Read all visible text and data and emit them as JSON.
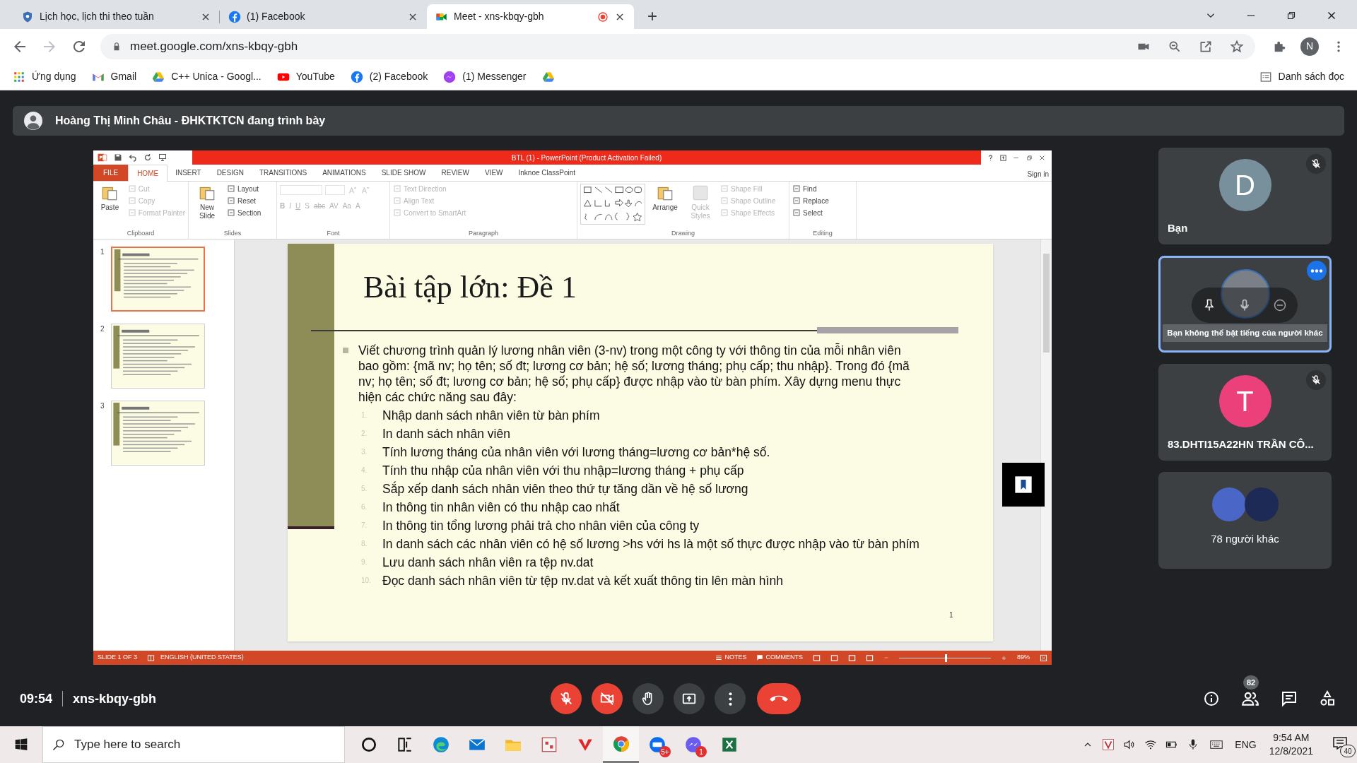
{
  "browser": {
    "tabs": [
      {
        "title": "Lịch học, lịch thi theo tuần",
        "kind": "school",
        "selected": false,
        "recording": false
      },
      {
        "title": "(1) Facebook",
        "kind": "facebook",
        "selected": false,
        "recording": false
      },
      {
        "title": "Meet - xns-kbqy-gbh",
        "kind": "meet",
        "selected": true,
        "recording": true
      }
    ],
    "address": "meet.google.com/xns-kbqy-gbh",
    "profile_initial": "N",
    "bookmarks": [
      {
        "label": "Ứng dụng",
        "kind": "apps"
      },
      {
        "label": "Gmail",
        "kind": "gmail"
      },
      {
        "label": "C++ Unica - Googl...",
        "kind": "drive"
      },
      {
        "label": "YouTube",
        "kind": "youtube"
      },
      {
        "label": "(2) Facebook",
        "kind": "facebook"
      },
      {
        "label": "(1) Messenger",
        "kind": "messenger"
      },
      {
        "kind": "drive"
      }
    ],
    "reading_list": "Danh sách đọc"
  },
  "presenter_banner": "Hoàng Thị Minh Châu - ĐHKTKTCN đang trình bày",
  "powerpoint": {
    "title": "BTL (1) -  PowerPoint (Product Activation Failed)",
    "sign_in": "Sign in",
    "menu_tabs": [
      {
        "label": "FILE",
        "kind": "file",
        "selected": false
      },
      {
        "label": "HOME",
        "kind": "tab",
        "selected": true
      },
      {
        "label": "INSERT",
        "kind": "tab",
        "selected": false
      },
      {
        "label": "DESIGN",
        "kind": "tab",
        "selected": false
      },
      {
        "label": "TRANSITIONS",
        "kind": "tab",
        "selected": false
      },
      {
        "label": "ANIMATIONS",
        "kind": "tab",
        "selected": false
      },
      {
        "label": "SLIDE SHOW",
        "kind": "tab",
        "selected": false
      },
      {
        "label": "REVIEW",
        "kind": "tab",
        "selected": false
      },
      {
        "label": "VIEW",
        "kind": "tab",
        "selected": false
      },
      {
        "label": "Inknoe ClassPoint",
        "kind": "tab",
        "selected": false
      }
    ],
    "ribbon_groups": [
      {
        "label": "Clipboard",
        "buttons": [
          {
            "label": "Paste",
            "kind": "large",
            "disabled": false
          },
          {
            "label": "Cut",
            "kind": "small",
            "disabled": true
          },
          {
            "label": "Copy",
            "kind": "small",
            "disabled": true
          },
          {
            "label": "Format Painter",
            "kind": "small",
            "disabled": true
          }
        ]
      },
      {
        "label": "Slides",
        "buttons": [
          {
            "label": "New Slide",
            "kind": "large",
            "disabled": false
          },
          {
            "label": "Layout",
            "kind": "small",
            "disabled": false
          },
          {
            "label": "Reset",
            "kind": "small",
            "disabled": false
          },
          {
            "label": "Section",
            "kind": "small",
            "disabled": false
          }
        ]
      },
      {
        "label": "Font",
        "buttons": [
          {
            "label": "B",
            "kind": "glyph",
            "disabled": true
          },
          {
            "label": "I",
            "kind": "glyph",
            "disabled": true
          },
          {
            "label": "U",
            "kind": "glyph",
            "disabled": true
          },
          {
            "label": "S",
            "kind": "glyph",
            "disabled": true
          },
          {
            "label": "abc",
            "kind": "glyph",
            "disabled": true
          },
          {
            "label": "AV",
            "kind": "glyph",
            "disabled": true
          },
          {
            "label": "Aa",
            "kind": "glyph",
            "disabled": true
          },
          {
            "label": "A",
            "kind": "glyph",
            "disabled": true
          }
        ]
      },
      {
        "label": "Paragraph",
        "buttons": [
          {
            "label": "Text Direction",
            "kind": "small",
            "disabled": true
          },
          {
            "label": "Align Text",
            "kind": "small",
            "disabled": true
          },
          {
            "label": "Convert to SmartArt",
            "kind": "small",
            "disabled": true
          }
        ]
      },
      {
        "label": "Drawing",
        "buttons": [
          {
            "kind": "shapes",
            "disabled": false
          },
          {
            "label": "Arrange",
            "kind": "large",
            "disabled": false
          },
          {
            "label": "Quick Styles",
            "kind": "large",
            "disabled": true
          },
          {
            "label": "Shape Fill",
            "kind": "small",
            "disabled": true
          },
          {
            "label": "Shape Outline",
            "kind": "small",
            "disabled": true
          },
          {
            "label": "Shape Effects",
            "kind": "small",
            "disabled": true
          }
        ]
      },
      {
        "label": "Editing",
        "buttons": [
          {
            "label": "Find",
            "kind": "small",
            "disabled": false
          },
          {
            "label": "Replace",
            "kind": "small",
            "disabled": false
          },
          {
            "label": "Select",
            "kind": "small",
            "disabled": false
          }
        ]
      }
    ],
    "thumbnails": [
      {
        "number": "1",
        "selected": true
      },
      {
        "number": "2",
        "selected": false
      },
      {
        "number": "3",
        "selected": false
      }
    ],
    "slide": {
      "title": "Bài tập lớn: Đề 1",
      "bullet": "Viết chương trình quản lý lương nhân viên (3-nv) trong một công ty với thông tin của mỗi nhân viên bao gồm: {mã nv; họ tên; số đt; lương cơ bản; hệ số; lương tháng; phụ cấp; thu nhập}. Trong đó {mã nv; họ tên; số đt; lương cơ bản; hệ số; phụ cấp} được nhập vào từ bàn phím. Xây dựng menu thực hiện các chức năng sau đây:",
      "items": [
        {
          "number": "1.",
          "text": "Nhập danh sách nhân viên từ bàn phím"
        },
        {
          "number": "2.",
          "text": "In danh sách nhân viên"
        },
        {
          "number": "3.",
          "text": "Tính lương tháng của nhân viên với lương tháng=lương cơ bản*hệ số."
        },
        {
          "number": "4.",
          "text": "Tính thu nhập của nhân viên với thu nhập=lương tháng + phụ cấp"
        },
        {
          "number": "5.",
          "text": "Sắp xếp danh sách nhân viên theo thứ tự tăng dần về hệ số lương"
        },
        {
          "number": "6.",
          "text": "In thông tin nhân viên có thu nhập cao nhất"
        },
        {
          "number": "7.",
          "text": "In thông tin tổng lương phải trả cho nhân viên của công ty"
        },
        {
          "number": "8.",
          "text": "In danh sách các nhân viên có hệ số lương >hs với hs là một số thực được nhập vào từ bàn phím"
        },
        {
          "number": "9.",
          "text": "Lưu danh sách nhân viên ra tệp nv.dat"
        },
        {
          "number": "10.",
          "text": "Đọc danh sách nhân viên từ tệp nv.dat và kết xuất thông tin lên màn hình"
        }
      ],
      "page_number": "1"
    },
    "status_bar": {
      "slide_info": "SLIDE 1 OF 3",
      "language": "ENGLISH (UNITED STATES)",
      "notes": "NOTES",
      "comments": "COMMENTS",
      "zoom": "89%",
      "zoom_slider": {
        "level": 0.5
      }
    }
  },
  "participants": [
    {
      "kind": "avatar",
      "initial": "D",
      "color": "#78909c",
      "name": "Bạn",
      "muted": true
    },
    {
      "kind": "video",
      "tooltip": "Bạn không thể bật tiếng của người khác"
    },
    {
      "kind": "avatar",
      "initial": "T",
      "color": "#ec407a",
      "name": "83.DHTI15A22HN TRẦN CÔ...",
      "muted": true
    },
    {
      "kind": "group",
      "label": "78 người khác"
    }
  ],
  "meeting": {
    "time": "09:54",
    "code": "xns-kbqy-gbh",
    "mic_on": false,
    "camera_on": false,
    "people_count": "82"
  },
  "taskbar": {
    "search_placeholder": "Type here to search",
    "apps": [
      {
        "kind": "cortana",
        "selected": false
      },
      {
        "kind": "taskview",
        "selected": false
      },
      {
        "kind": "edge",
        "selected": false
      },
      {
        "kind": "mail",
        "selected": false
      },
      {
        "kind": "explorer",
        "selected": false
      },
      {
        "kind": "snip",
        "selected": false
      },
      {
        "kind": "vivaldi",
        "selected": false
      },
      {
        "kind": "chrome",
        "selected": true
      },
      {
        "kind": "zalo",
        "selected": false,
        "badge": "5+"
      },
      {
        "kind": "messenger",
        "selected": false,
        "badge": "1"
      },
      {
        "kind": "excel",
        "selected": false
      }
    ],
    "language": "ENG",
    "time": "9:54 AM",
    "date": "12/8/2021",
    "notifications": "40"
  }
}
